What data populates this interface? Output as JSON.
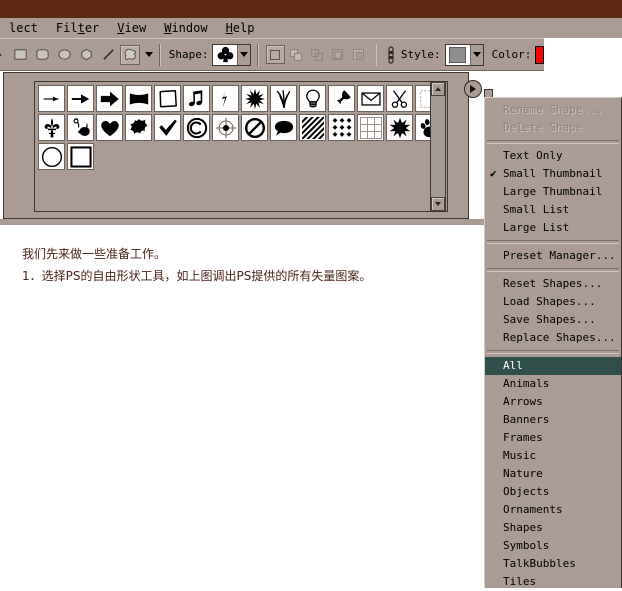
{
  "app": {
    "titlebar_color": "#5c2a10",
    "chrome_color": "#aa9c94",
    "highlight_color": "#2f4f4a",
    "accent_color": "#ff0000"
  },
  "menubar": {
    "items": [
      {
        "name": "menu-select",
        "label": "lect"
      },
      {
        "name": "menu-filter",
        "label": "Filter"
      },
      {
        "name": "menu-view",
        "label": "View"
      },
      {
        "name": "menu-window",
        "label": "Window"
      },
      {
        "name": "menu-help",
        "label": "Help"
      }
    ]
  },
  "options_bar": {
    "shape_tools": [
      {
        "name": "rectangle-tool",
        "icon": "rectangle-icon",
        "selected": false
      },
      {
        "name": "rounded-rectangle-tool",
        "icon": "rounded-rectangle-icon",
        "selected": false
      },
      {
        "name": "ellipse-tool",
        "icon": "ellipse-icon",
        "selected": false
      },
      {
        "name": "polygon-tool",
        "icon": "polygon-icon",
        "selected": false
      },
      {
        "name": "line-tool",
        "icon": "line-icon",
        "selected": false
      },
      {
        "name": "custom-shape-tool",
        "icon": "custom-shape-icon",
        "selected": true
      }
    ],
    "shape_label": "Shape:",
    "shape_value": "club-shape",
    "style_label": "Style:",
    "style_value": "gray-swatch",
    "color_label": "Color:",
    "color_value": "#ff0000",
    "geometry_icon": "link-geometry-icon",
    "state_buttons": [
      {
        "name": "create-new-shape-layer-button",
        "selected": true
      },
      {
        "name": "add-to-shape-area-button",
        "selected": false
      },
      {
        "name": "subtract-from-shape-area-button",
        "selected": false
      },
      {
        "name": "intersect-shape-areas-button",
        "selected": false
      },
      {
        "name": "exclude-overlapping-shape-areas-button",
        "selected": false
      }
    ]
  },
  "shape_picker": {
    "menu_button": "picker-menu-button",
    "scrollbar": {
      "up": "scroll-up-arrow-icon",
      "down": "scroll-down-arrow-icon"
    },
    "shapes": [
      {
        "name": "arrow-thin-shape",
        "icon": "arrow-thin-icon"
      },
      {
        "name": "arrow-medium-shape",
        "icon": "arrow-medium-icon"
      },
      {
        "name": "arrow-thick-shape",
        "icon": "arrow-thick-icon"
      },
      {
        "name": "banner-shape",
        "icon": "banner-icon"
      },
      {
        "name": "torn-frame-shape",
        "icon": "torn-frame-icon"
      },
      {
        "name": "music-note-shape",
        "icon": "music-note-icon"
      },
      {
        "name": "lightning-shape",
        "icon": "lightning-icon"
      },
      {
        "name": "starburst-shape",
        "icon": "starburst-icon"
      },
      {
        "name": "grass-shape",
        "icon": "grass-icon"
      },
      {
        "name": "lightbulb-shape",
        "icon": "lightbulb-icon"
      },
      {
        "name": "pushpin-shape",
        "icon": "pushpin-icon"
      },
      {
        "name": "envelope-shape",
        "icon": "envelope-icon"
      },
      {
        "name": "scissors-shape",
        "icon": "scissors-icon"
      },
      {
        "name": "dashed-square-shape",
        "icon": "dashed-square-icon"
      },
      {
        "name": "fleur-de-lis-shape",
        "icon": "fleur-de-lis-icon"
      },
      {
        "name": "cat-ornament-shape",
        "icon": "cat-ornament-icon"
      },
      {
        "name": "heart-shape",
        "icon": "heart-icon"
      },
      {
        "name": "splat-shape",
        "icon": "splat-icon"
      },
      {
        "name": "checkmark-shape",
        "icon": "checkmark-icon"
      },
      {
        "name": "copyright-shape",
        "icon": "copyright-icon"
      },
      {
        "name": "crosshair-shape",
        "icon": "crosshair-icon"
      },
      {
        "name": "no-entry-shape",
        "icon": "no-entry-icon"
      },
      {
        "name": "talk-bubble-shape",
        "icon": "talk-bubble-icon"
      },
      {
        "name": "diagonal-hatch-tile-shape",
        "icon": "diagonal-hatch-tile-icon"
      },
      {
        "name": "diamond-grid-tile-shape",
        "icon": "diamond-grid-tile-icon"
      },
      {
        "name": "grid-tile-shape",
        "icon": "grid-tile-icon"
      },
      {
        "name": "star-burst-shape",
        "icon": "star-burst-icon"
      },
      {
        "name": "paw-print-shape",
        "icon": "paw-print-icon"
      },
      {
        "name": "circle-frame-shape",
        "icon": "circle-frame-icon"
      },
      {
        "name": "square-frame-shape",
        "icon": "square-frame-icon"
      }
    ]
  },
  "context_menu": {
    "items": [
      {
        "name": "menu-rename-shape",
        "label": "Rename Shape...",
        "state": "disabled"
      },
      {
        "name": "menu-delete-shape",
        "label": "Delete Shape",
        "state": "disabled"
      },
      {
        "type": "separator"
      },
      {
        "name": "menu-text-only",
        "label": "Text Only",
        "state": "normal"
      },
      {
        "name": "menu-small-thumbnail",
        "label": "Small Thumbnail",
        "state": "checked"
      },
      {
        "name": "menu-large-thumbnail",
        "label": "Large Thumbnail",
        "state": "normal"
      },
      {
        "name": "menu-small-list",
        "label": "Small List",
        "state": "normal"
      },
      {
        "name": "menu-large-list",
        "label": "Large List",
        "state": "normal"
      },
      {
        "type": "separator"
      },
      {
        "name": "menu-preset-manager",
        "label": "Preset Manager...",
        "state": "normal"
      },
      {
        "type": "separator"
      },
      {
        "name": "menu-reset-shapes",
        "label": "Reset Shapes...",
        "state": "normal"
      },
      {
        "name": "menu-load-shapes",
        "label": "Load Shapes...",
        "state": "normal"
      },
      {
        "name": "menu-save-shapes",
        "label": "Save Shapes...",
        "state": "normal"
      },
      {
        "name": "menu-replace-shapes",
        "label": "Replace Shapes...",
        "state": "normal"
      },
      {
        "type": "separator"
      },
      {
        "name": "menu-category-all",
        "label": "All",
        "state": "selected"
      },
      {
        "name": "menu-category-animals",
        "label": "Animals",
        "state": "normal"
      },
      {
        "name": "menu-category-arrows",
        "label": "Arrows",
        "state": "normal"
      },
      {
        "name": "menu-category-banners",
        "label": "Banners",
        "state": "normal"
      },
      {
        "name": "menu-category-frames",
        "label": "Frames",
        "state": "normal"
      },
      {
        "name": "menu-category-music",
        "label": "Music",
        "state": "normal"
      },
      {
        "name": "menu-category-nature",
        "label": "Nature",
        "state": "normal"
      },
      {
        "name": "menu-category-objects",
        "label": "Objects",
        "state": "normal"
      },
      {
        "name": "menu-category-ornaments",
        "label": "Ornaments",
        "state": "normal"
      },
      {
        "name": "menu-category-shapes",
        "label": "Shapes",
        "state": "normal"
      },
      {
        "name": "menu-category-symbols",
        "label": "Symbols",
        "state": "normal"
      },
      {
        "name": "menu-category-talkbubbles",
        "label": "TalkBubbles",
        "state": "normal"
      },
      {
        "name": "menu-category-tiles",
        "label": "Tiles",
        "state": "normal"
      }
    ]
  },
  "article": {
    "lines": [
      "我们先来做一些准备工作。",
      "1．选择PS的自由形状工具，如上图调出PS提供的所有失量图案。"
    ]
  }
}
